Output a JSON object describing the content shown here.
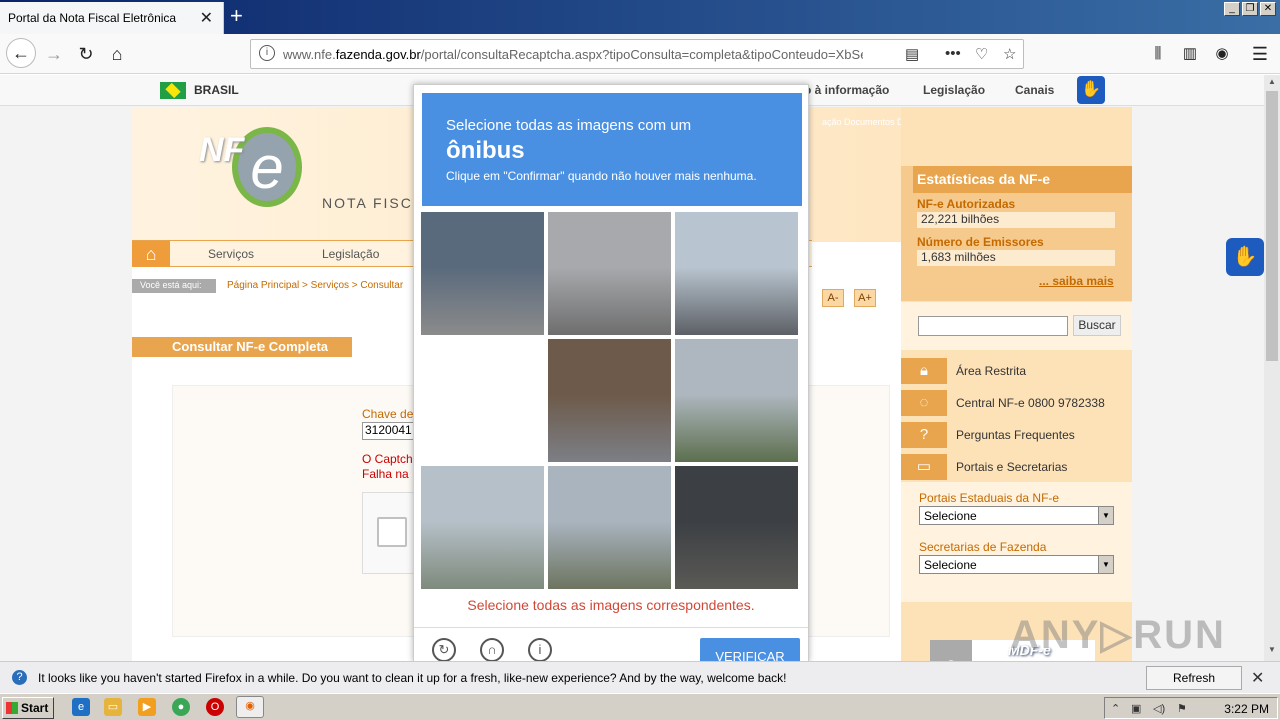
{
  "browser": {
    "tab_title": "Portal da Nota Fiscal Eletrônica",
    "tab_close": "✕",
    "new_tab": "+",
    "url_prefix": "www.nfe.",
    "url_domain": "fazenda.gov.br",
    "url_rest": "/portal/consultaRecaptcha.aspx?tipoConsulta=completa&tipoConteudo=XbSe",
    "window_buttons": [
      "_",
      "❐",
      "✕"
    ]
  },
  "govbar": {
    "brasil": "BRASIL",
    "links": [
      "o à informação",
      "Legislação",
      "Canais"
    ]
  },
  "site": {
    "nota_fiscal": "NOTA FISCAL",
    "toplinks": "ação  Documentos  Downloads  Área Restrita  Documentos e outros",
    "menu": [
      "Serviços",
      "Legislação"
    ],
    "crumb_label": "Você está aqui:",
    "crumb_path": "Página Principal > Serviços > Consultar",
    "font_minus": "A-",
    "font_plus": "A+",
    "page_title": "Consultar NF-e Completa",
    "chave_label": "Chave de",
    "chave_value": "3120041",
    "err1": "O Captch",
    "err2": "Falha na"
  },
  "sidebar": {
    "stats_title": "Estatísticas da NF-e",
    "authorized_label": "NF-e Autorizadas",
    "authorized_value": "22,221 bilhões",
    "emitters_label": "Número de Emissores",
    "emitters_value": "1,683 milhões",
    "more": "... saiba mais",
    "search_button": "Buscar",
    "items": [
      {
        "label": "Área Restrita",
        "icon": "lock-icon"
      },
      {
        "label": "Central NF-e 0800 9782338",
        "icon": "phone-icon"
      },
      {
        "label": "Perguntas Frequentes",
        "icon": "question-icon"
      },
      {
        "label": "Portais e Secretarias",
        "icon": "window-icon"
      }
    ],
    "portais_label": "Portais Estaduais da NF-e",
    "portais_value": "Selecione",
    "secretarias_label": "Secretarias de Fazenda",
    "secretarias_value": "Selecione",
    "mdfe": "MDF-e"
  },
  "captcha": {
    "line1": "Selecione todas as imagens com um",
    "object": "ônibus",
    "line3": "Clique em \"Confirmar\" quando não houver mais nenhuma.",
    "error": "Selecione todas as imagens correspondentes.",
    "verify": "VERIFICAR",
    "tiles": [
      {
        "desc": "street-bus",
        "c1": "#5a6a7d",
        "c2": "#8b8b8b"
      },
      {
        "desc": "crosswalk",
        "c1": "#a7a9ac",
        "c2": "#6e6e6e"
      },
      {
        "desc": "street",
        "c1": "#b8c4cf",
        "c2": "#5d6066"
      },
      {
        "desc": "empty",
        "c1": "#ffffff",
        "c2": "#ffffff"
      },
      {
        "desc": "bus-building",
        "c1": "#6d5a4a",
        "c2": "#7c7f86"
      },
      {
        "desc": "field-sky",
        "c1": "#aeb7bf",
        "c2": "#5c6f4e"
      },
      {
        "desc": "hills-sky",
        "c1": "#b6c0c9",
        "c2": "#7e8a7c"
      },
      {
        "desc": "road-hill",
        "c1": "#a9b4bf",
        "c2": "#6d7460"
      },
      {
        "desc": "dark-wall",
        "c1": "#3c3f44",
        "c2": "#5a5a55"
      }
    ]
  },
  "notification": {
    "message": "It looks like you haven't started Firefox in a while. Do you want to clean it up for a fresh, like-new experience? And by the way, welcome back!",
    "refresh": "Refresh Firefox…",
    "close": "✕"
  },
  "taskbar": {
    "start": "Start",
    "time": "3:22 PM"
  },
  "watermark": "ANY.RUN"
}
